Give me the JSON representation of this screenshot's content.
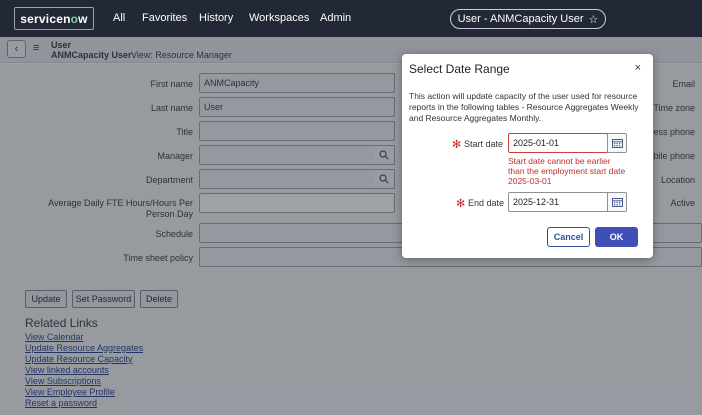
{
  "nav": {
    "logo_prefix": "servicen",
    "logo_o": "o",
    "logo_suffix": "w",
    "items": [
      "All",
      "Favorites",
      "History",
      "Workspaces",
      "Admin"
    ],
    "record_pill": "User - ANMCapacity User",
    "pill_star": "☆"
  },
  "subheader": {
    "back_icon": "‹",
    "menu_icon": "≡",
    "record_type": "User",
    "record_name": "ANMCapacity User",
    "view": "View: Resource Manager"
  },
  "form": {
    "first_name_label": "First name",
    "first_name_value": "ANMCapacity",
    "last_name_label": "Last name",
    "last_name_value": "User",
    "title_label": "Title",
    "manager_label": "Manager",
    "department_label": "Department",
    "fte_label_line1": "Average Daily FTE Hours/Hours Per",
    "fte_label_line2": "Person Day",
    "schedule_label": "Schedule",
    "timesheet_label": "Time sheet policy",
    "right_labels": {
      "email": "Email",
      "time_zone": "Time zone",
      "business_phone": "ness phone",
      "mobile_phone": "obile phone",
      "location": "Location",
      "active": "Active"
    }
  },
  "actions": {
    "update": "Update",
    "set_password": "Set Password",
    "delete": "Delete"
  },
  "related": {
    "title": "Related Links",
    "links": [
      "View Calendar",
      "Update Resource Aggregates",
      "Update Resource Capacity",
      "View linked accounts",
      "View Subscriptions",
      "View Employee Profile",
      "Reset a password"
    ]
  },
  "modal": {
    "title": "Select Date Range",
    "close": "×",
    "description": "This action will update capacity of the user used for resource reports in the following tables - Resource Aggregates Weekly and Resource Aggregates Monthly.",
    "required_mark": "✻",
    "start_label": "Start date",
    "start_value": "2025-01-01",
    "start_error": "Start date cannot be earlier than the employment start date 2025-03-01",
    "end_label": "End date",
    "end_value": "2025-12-31",
    "cancel": "Cancel",
    "ok": "OK"
  },
  "colors": {
    "nav_bg": "#222835",
    "error": "#c52b2b",
    "primary": "#3f4fb6",
    "link": "#1f3a8a"
  }
}
